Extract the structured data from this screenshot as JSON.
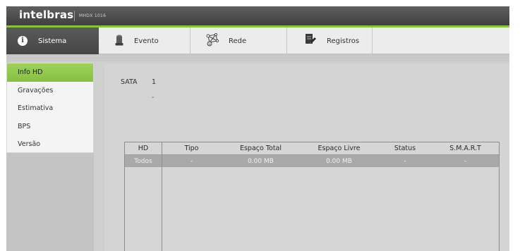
{
  "brand": {
    "logo": "intelbras",
    "model": "MHDX 1016",
    "accent_color": "#86c440"
  },
  "tabs": [
    {
      "label": "Sistema",
      "icon": "info-icon",
      "active": true
    },
    {
      "label": "Evento",
      "icon": "siren-icon",
      "active": false
    },
    {
      "label": "Rede",
      "icon": "network-icon",
      "active": false
    },
    {
      "label": "Registros",
      "icon": "log-pen-icon",
      "active": false
    }
  ],
  "sidebar": {
    "items": [
      {
        "label": "Info HD",
        "active": true
      },
      {
        "label": "Gravações",
        "active": false
      },
      {
        "label": "Estimativa",
        "active": false
      },
      {
        "label": "BPS",
        "active": false
      },
      {
        "label": "Versão",
        "active": false
      }
    ]
  },
  "hd_info": {
    "sata_label": "SATA",
    "sata_number": "1",
    "sata_value": "-"
  },
  "table": {
    "headers": [
      "HD",
      "Tipo",
      "Espaço Total",
      "Espaço Livre",
      "Status",
      "S.M.A.R.T"
    ],
    "rows": [
      [
        "Todos",
        "-",
        "0.00 MB",
        "0.00 MB",
        "-",
        "-"
      ]
    ]
  }
}
